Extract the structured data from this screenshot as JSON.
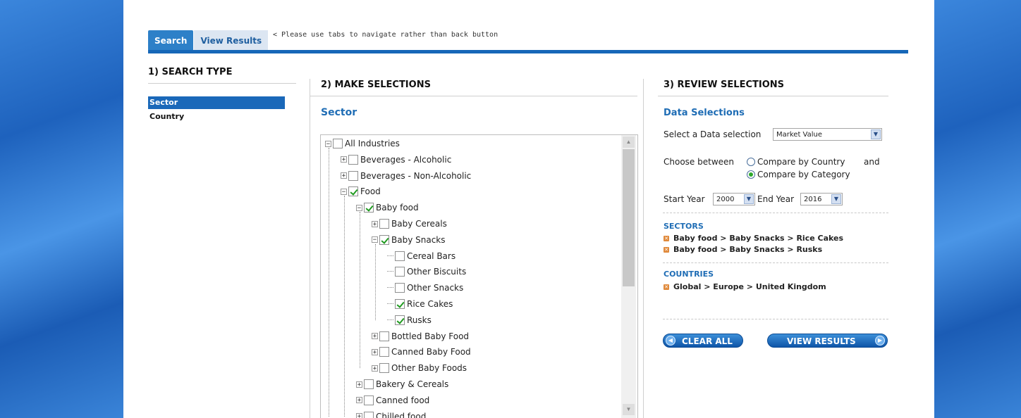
{
  "tabs": [
    {
      "label": "Search"
    },
    {
      "label": "View Results"
    }
  ],
  "nav_note": "< Please use tabs to navigate rather than back button",
  "search_type": {
    "heading": "1) SEARCH TYPE",
    "items": [
      {
        "label": "Sector"
      },
      {
        "label": "Country"
      }
    ]
  },
  "make_selections": {
    "heading": "2) MAKE SELECTIONS",
    "subheading": "Sector",
    "tree": [
      {
        "label": "All Industries",
        "expander": "minus",
        "checked": false
      },
      {
        "label": "Beverages - Alcoholic",
        "expander": "plus",
        "checked": false
      },
      {
        "label": "Beverages - Non-Alcoholic",
        "expander": "plus",
        "checked": false
      },
      {
        "label": "Food",
        "expander": "minus",
        "checked": true
      },
      {
        "label": "Baby food",
        "expander": "minus",
        "checked": true
      },
      {
        "label": "Baby Cereals",
        "expander": "plus",
        "checked": false
      },
      {
        "label": "Baby Snacks",
        "expander": "minus",
        "checked": true
      },
      {
        "label": "Cereal Bars",
        "expander": "none",
        "checked": false
      },
      {
        "label": "Other Biscuits",
        "expander": "none",
        "checked": false
      },
      {
        "label": "Other Snacks",
        "expander": "none",
        "checked": false
      },
      {
        "label": "Rice Cakes",
        "expander": "none",
        "checked": true
      },
      {
        "label": "Rusks",
        "expander": "none",
        "checked": true
      },
      {
        "label": "Bottled Baby Food",
        "expander": "plus",
        "checked": false
      },
      {
        "label": "Canned Baby Food",
        "expander": "plus",
        "checked": false
      },
      {
        "label": "Other Baby Foods",
        "expander": "plus",
        "checked": false
      },
      {
        "label": "Bakery & Cereals",
        "expander": "plus",
        "checked": false
      },
      {
        "label": "Canned food",
        "expander": "plus",
        "checked": false
      },
      {
        "label": "Chilled food",
        "expander": "plus",
        "checked": false
      }
    ]
  },
  "review": {
    "heading": "3) REVIEW SELECTIONS",
    "subheading": "Data Selections",
    "data_selection_label": "Select a Data selection",
    "data_selection_value": "Market Value",
    "choose_between_label": "Choose between",
    "compare_country_label": "Compare by Country",
    "and_label": "and",
    "compare_category_label": "Compare by Category",
    "start_year_label": "Start Year",
    "start_year_value": "2000",
    "end_year_label": "End Year",
    "end_year_value": "2016",
    "sectors_heading": "SECTORS",
    "sectors": [
      "Baby food > Baby Snacks > Rice Cakes",
      "Baby food > Baby Snacks > Rusks"
    ],
    "countries_heading": "COUNTRIES",
    "countries": [
      "Global > Europe > United Kingdom"
    ],
    "clear_all_label": "CLEAR ALL",
    "view_results_label": "VIEW RESULTS"
  },
  "colors": {
    "accent": "#1a68b9",
    "heading_blue": "#1f6db5",
    "remove_icon": "#e08a3c"
  }
}
